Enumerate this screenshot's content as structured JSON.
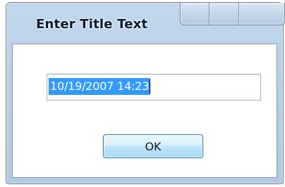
{
  "dialog": {
    "title": "Enter Title Text",
    "input": {
      "value": "10/19/2007 14:23",
      "selected": true
    },
    "ok_label": "OK"
  },
  "colors": {
    "selection": "#3399ff",
    "frame": "#b9cfe6",
    "button_border": "#3c7fb1"
  }
}
